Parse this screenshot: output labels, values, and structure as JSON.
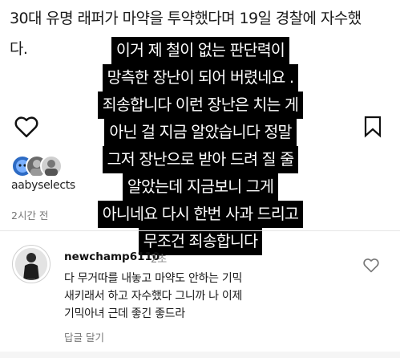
{
  "post": {
    "caption_line1": "30대 유명 래퍼가 마약을 투약했다며 19일 경찰에 자수했",
    "caption_line2": "다."
  },
  "overlay": {
    "lines": [
      "이거 제 철이 없는 판단력이",
      "망측한 장난이 되어 버렸네요 .",
      "죄송합니다 이런 장난은 치는 게",
      "아닌 걸 지금 알았습니다 정말",
      "그저 장난으로 받아 드려 질 줄",
      "알았는데 지금보니 그게",
      "아니네요 다시 한번 사과 드리고",
      "무조건 죄송합니다"
    ]
  },
  "likes": {
    "liker": "aabyselects",
    "time_ago": "2시간 전"
  },
  "comment": {
    "username": "newchamp6110",
    "time": "2초",
    "text_line1": "다 무거따를 내놓고 마약도 안하는 기믹",
    "text_line2": "새키래서 하고 자수했다 그니까 나 이제",
    "text_line3": "기믹아녀 근데 좋긴 좋드라",
    "reply_label": "답글 달기"
  },
  "icons": {
    "like": "heart-icon",
    "save": "bookmark-icon",
    "comment_like": "heart-icon"
  }
}
